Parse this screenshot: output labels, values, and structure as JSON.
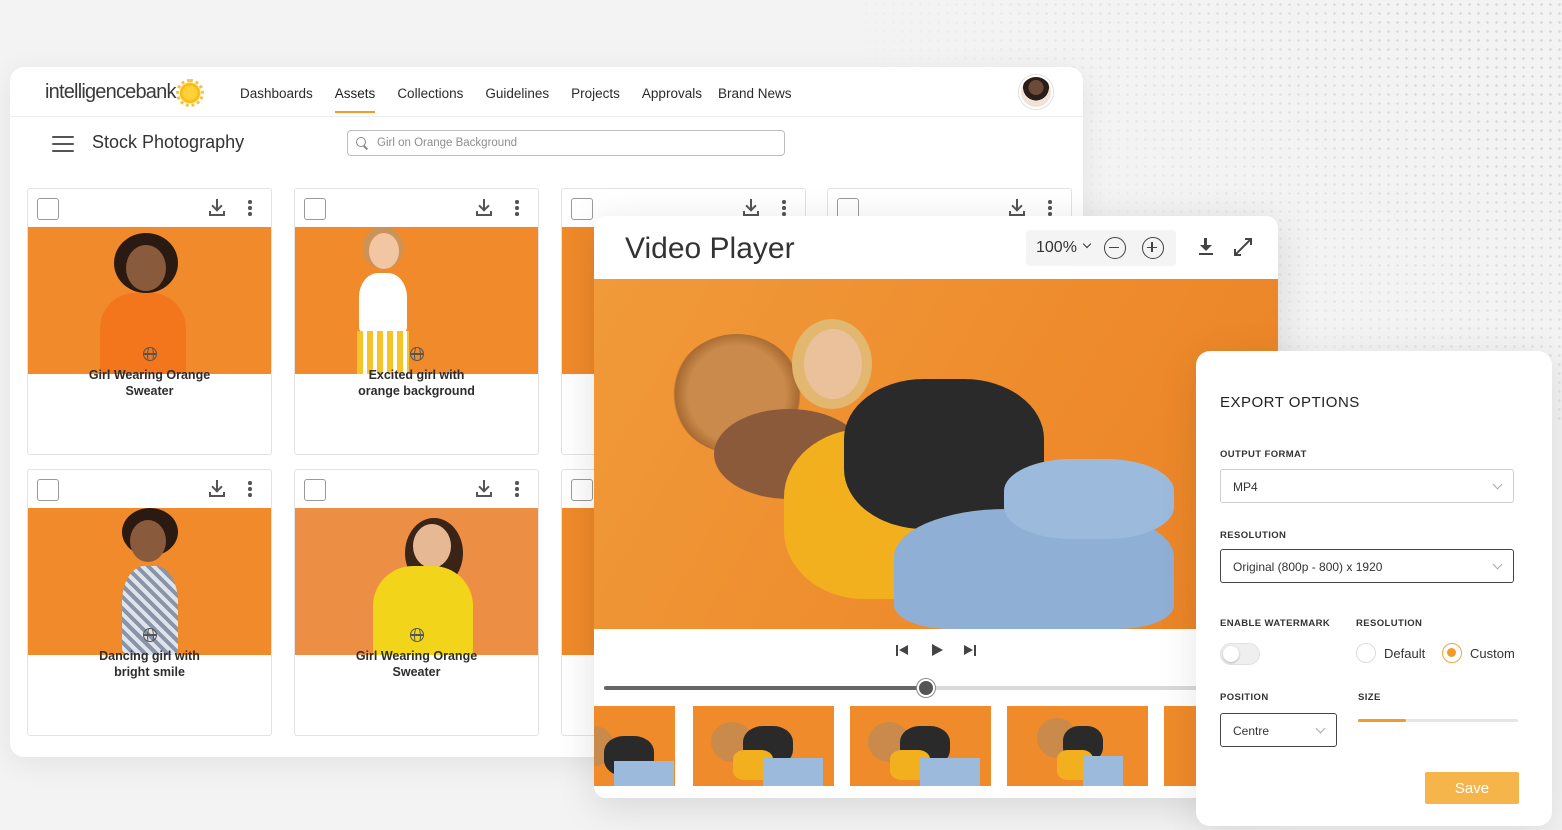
{
  "app": {
    "logo_text": "intelligencebank",
    "nav": [
      "Dashboards",
      "Assets",
      "Collections",
      "Guidelines",
      "Projects",
      "Approvals",
      "Brand News"
    ],
    "active_nav": "Assets",
    "page_title": "Stock Photography",
    "search": {
      "placeholder": "Girl on Orange Background"
    }
  },
  "assets": [
    {
      "title_line1": "Girl Wearing Orange",
      "title_line2": "Sweater"
    },
    {
      "title_line1": "Excited girl with",
      "title_line2": "orange background"
    },
    {
      "title_line1": "Dancing girl with",
      "title_line2": "bright smile"
    },
    {
      "title_line1": "Girl Wearing Orange",
      "title_line2": "Sweater"
    }
  ],
  "player": {
    "title": "Video Player",
    "zoom": "100%",
    "progress": 0.485
  },
  "export": {
    "title": "EXPORT OPTIONS",
    "output_format_label": "OUTPUT FORMAT",
    "output_format": "MP4",
    "resolution_label": "RESOLUTION",
    "resolution": "Original (800p - 800) x 1920",
    "watermark_label": "ENABLE WATERMARK",
    "watermark_enabled": false,
    "resolution2_label": "RESOLUTION",
    "resolution_options": [
      "Default",
      "Custom"
    ],
    "resolution_selected": "Custom",
    "position_label": "POSITION",
    "position": "Centre",
    "size_label": "SIZE",
    "size_value": 0.3,
    "save_label": "Save"
  },
  "colors": {
    "accent": "#f39a2b",
    "photo_bg": "#f08a2a",
    "save_bg": "#f6b54a"
  }
}
